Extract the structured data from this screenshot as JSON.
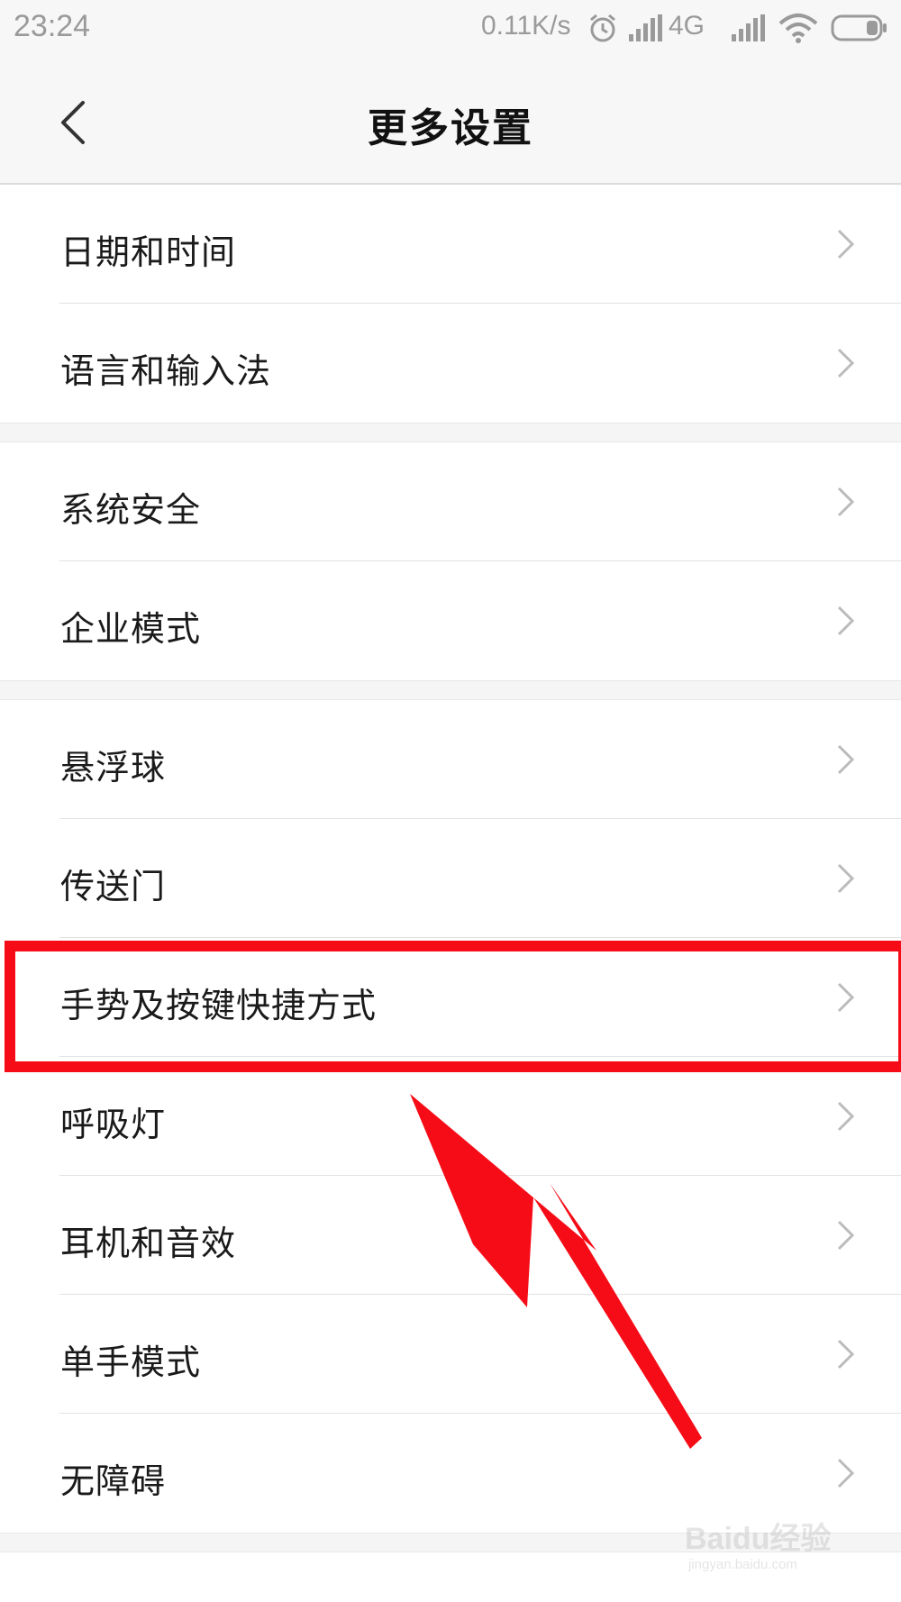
{
  "status": {
    "time": "23:24",
    "speed": "0.11K/s",
    "network": "4G",
    "icons": [
      "alarm-icon",
      "signal-icon",
      "signal-icon-2",
      "wifi-icon",
      "battery-icon"
    ]
  },
  "header": {
    "title": "更多设置",
    "back_icon": "back-arrow-icon"
  },
  "groups": [
    {
      "items": [
        {
          "label": "日期和时间"
        },
        {
          "label": "语言和输入法"
        }
      ]
    },
    {
      "items": [
        {
          "label": "系统安全"
        },
        {
          "label": "企业模式"
        }
      ]
    },
    {
      "items": [
        {
          "label": "悬浮球"
        },
        {
          "label": "传送门"
        },
        {
          "label": "手势及按键快捷方式"
        },
        {
          "label": "呼吸灯"
        },
        {
          "label": "耳机和音效"
        },
        {
          "label": "单手模式"
        },
        {
          "label": "无障碍"
        }
      ]
    }
  ],
  "annotation": {
    "highlight_color": "#f60c17",
    "highlighted_item": "手势及按键快捷方式"
  },
  "watermark": {
    "text": "Baidu经验",
    "url": "jingyan.baidu.com"
  }
}
